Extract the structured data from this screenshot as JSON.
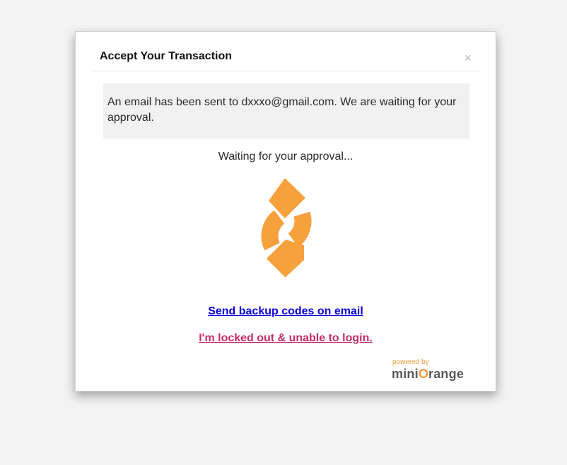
{
  "modal": {
    "title": "Accept Your Transaction",
    "close_glyph": "×",
    "notice": "An email has been sent to dxxxo@gmail.com. We are waiting for your approval.",
    "waiting_text": "Waiting for your approval...",
    "spinner_icon": "refresh-arrows-icon",
    "links": {
      "backup": "Send backup codes on email",
      "locked": "I'm locked out & unable to login."
    },
    "brand": {
      "powered_by": "powered by",
      "logo_pre": "mini",
      "logo_o": "O",
      "logo_post": "range"
    }
  },
  "colors": {
    "accent": "#f7a13d",
    "link_primary": "#0b00d8",
    "link_secondary": "#c62d66",
    "notice_bg": "#f1f1f1"
  }
}
